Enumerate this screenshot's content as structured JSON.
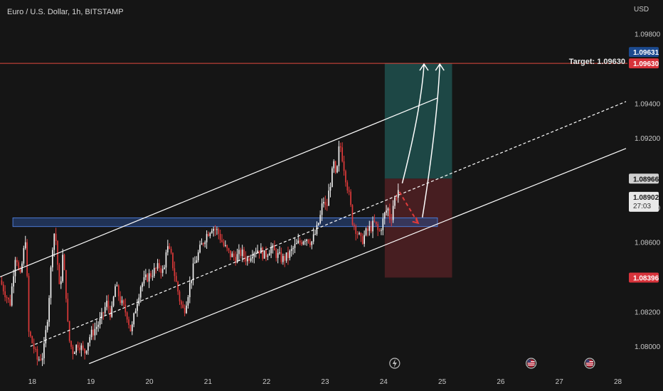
{
  "header": {
    "title": "Euro / U.S. Dollar, 1h, BITSTAMP",
    "currency": "USD"
  },
  "colors": {
    "background": "#151515",
    "up": "#f2f2f2",
    "down": "#e03a3a",
    "target_line": "#e0493e",
    "channel": "#ffffff",
    "zone": "#2a4a8a",
    "profit_box": "#1e4a48",
    "loss_box": "#4a1f22",
    "tag_blue": "#1c4a8f",
    "tag_red": "#d8333b",
    "tag_gray": "#d0d0d0"
  },
  "annotations": {
    "target_label": "Target: 1.09630",
    "target_price": 1.0963,
    "target_tag": "1.09630",
    "last_high_tag": "1.09631",
    "stop_tag": "1.08396",
    "entry_tag": "1.08966",
    "current_price": "1.08902",
    "countdown": "27:03",
    "zone_low": 1.0869,
    "zone_high": 1.0874,
    "position_entry": 1.08966,
    "position_target": 1.0963,
    "position_stop": 1.08396
  },
  "icons": [
    "lightning-event-icon",
    "us-flag-event-icon",
    "us-flag-event-icon"
  ],
  "chart_data": {
    "type": "candlestick",
    "title": "Euro / U.S. Dollar, 1h, BITSTAMP",
    "y_axis_unit": "USD",
    "y_ticks": [
      "1.09800",
      "1.09400",
      "1.09200",
      "1.08800",
      "1.08600",
      "1.08200",
      "1.08000"
    ],
    "y_tick_values": [
      1.098,
      1.094,
      1.092,
      1.088,
      1.086,
      1.082,
      1.08
    ],
    "x_ticks": [
      "18",
      "19",
      "20",
      "21",
      "22",
      "23",
      "24",
      "25",
      "26",
      "27",
      "28"
    ],
    "x_tick_days": [
      18,
      19,
      20,
      21,
      22,
      23,
      24,
      25,
      26,
      27,
      28
    ],
    "xlim_days": [
      17.48,
      28.17
    ],
    "ylim": [
      1.07845,
      1.09995
    ],
    "closes": [
      [
        17.48,
        1.0838
      ],
      [
        17.65,
        1.0824
      ],
      [
        17.75,
        1.0855
      ],
      [
        17.82,
        1.0838
      ],
      [
        17.92,
        1.0864
      ],
      [
        17.97,
        1.0808
      ],
      [
        18.05,
        1.08
      ],
      [
        18.12,
        1.0792
      ],
      [
        18.22,
        1.0795
      ],
      [
        18.3,
        1.082
      ],
      [
        18.38,
        1.086
      ],
      [
        18.42,
        1.0868
      ],
      [
        18.5,
        1.083
      ],
      [
        18.55,
        1.0852
      ],
      [
        18.6,
        1.0835
      ],
      [
        18.65,
        1.0805
      ],
      [
        18.72,
        1.0797
      ],
      [
        18.82,
        1.0802
      ],
      [
        18.92,
        1.0796
      ],
      [
        19.0,
        1.0805
      ],
      [
        19.1,
        1.081
      ],
      [
        19.2,
        1.0815
      ],
      [
        19.3,
        1.0825
      ],
      [
        19.38,
        1.0818
      ],
      [
        19.45,
        1.0835
      ],
      [
        19.55,
        1.0825
      ],
      [
        19.65,
        1.0818
      ],
      [
        19.72,
        1.0808
      ],
      [
        19.8,
        1.0823
      ],
      [
        19.88,
        1.0835
      ],
      [
        20.0,
        1.084
      ],
      [
        20.1,
        1.0843
      ],
      [
        20.2,
        1.0846
      ],
      [
        20.28,
        1.0842
      ],
      [
        20.32,
        1.0858
      ],
      [
        20.4,
        1.0852
      ],
      [
        20.48,
        1.0838
      ],
      [
        20.56,
        1.0825
      ],
      [
        20.62,
        1.082
      ],
      [
        20.7,
        1.0832
      ],
      [
        20.78,
        1.0845
      ],
      [
        20.85,
        1.0852
      ],
      [
        20.92,
        1.0858
      ],
      [
        21.0,
        1.0864
      ],
      [
        21.1,
        1.0869
      ],
      [
        21.2,
        1.0866
      ],
      [
        21.3,
        1.0858
      ],
      [
        21.4,
        1.0853
      ],
      [
        21.5,
        1.0851
      ],
      [
        21.6,
        1.0854
      ],
      [
        21.7,
        1.085
      ],
      [
        21.8,
        1.0855
      ],
      [
        21.9,
        1.0856
      ],
      [
        22.0,
        1.0852
      ],
      [
        22.1,
        1.0857
      ],
      [
        22.2,
        1.0853
      ],
      [
        22.3,
        1.085
      ],
      [
        22.4,
        1.0852
      ],
      [
        22.5,
        1.0857
      ],
      [
        22.6,
        1.086
      ],
      [
        22.7,
        1.0863
      ],
      [
        22.8,
        1.086
      ],
      [
        22.88,
        1.0866
      ],
      [
        22.95,
        1.0875
      ],
      [
        23.0,
        1.0885
      ],
      [
        23.05,
        1.0878
      ],
      [
        23.1,
        1.089
      ],
      [
        23.18,
        1.0905
      ],
      [
        23.22,
        1.0895
      ],
      [
        23.28,
        1.0918
      ],
      [
        23.32,
        1.091
      ],
      [
        23.38,
        1.0898
      ],
      [
        23.45,
        1.0885
      ],
      [
        23.5,
        1.0872
      ],
      [
        23.58,
        1.0866
      ],
      [
        23.65,
        1.086
      ],
      [
        23.72,
        1.0865
      ],
      [
        23.8,
        1.0868
      ],
      [
        23.88,
        1.0871
      ],
      [
        23.95,
        1.0865
      ],
      [
        24.0,
        1.087
      ],
      [
        24.05,
        1.0876
      ],
      [
        24.1,
        1.088
      ],
      [
        24.15,
        1.0872
      ],
      [
        24.2,
        1.0883
      ],
      [
        24.28,
        1.08902
      ]
    ],
    "overlays": {
      "horizontal_line": 1.0963,
      "channel_upper": [
        [
          17.48,
          1.084
        ],
        [
          24.95,
          1.0943
        ]
      ],
      "channel_mid": [
        [
          18.0,
          1.08
        ],
        [
          28.17,
          1.0941
        ]
      ],
      "channel_lower": [
        [
          19.0,
          1.079
        ],
        [
          28.17,
          1.0914
        ]
      ],
      "support_zone": [
        1.0869,
        1.0874
      ],
      "support_zone_days": [
        17.7,
        24.95
      ]
    }
  }
}
